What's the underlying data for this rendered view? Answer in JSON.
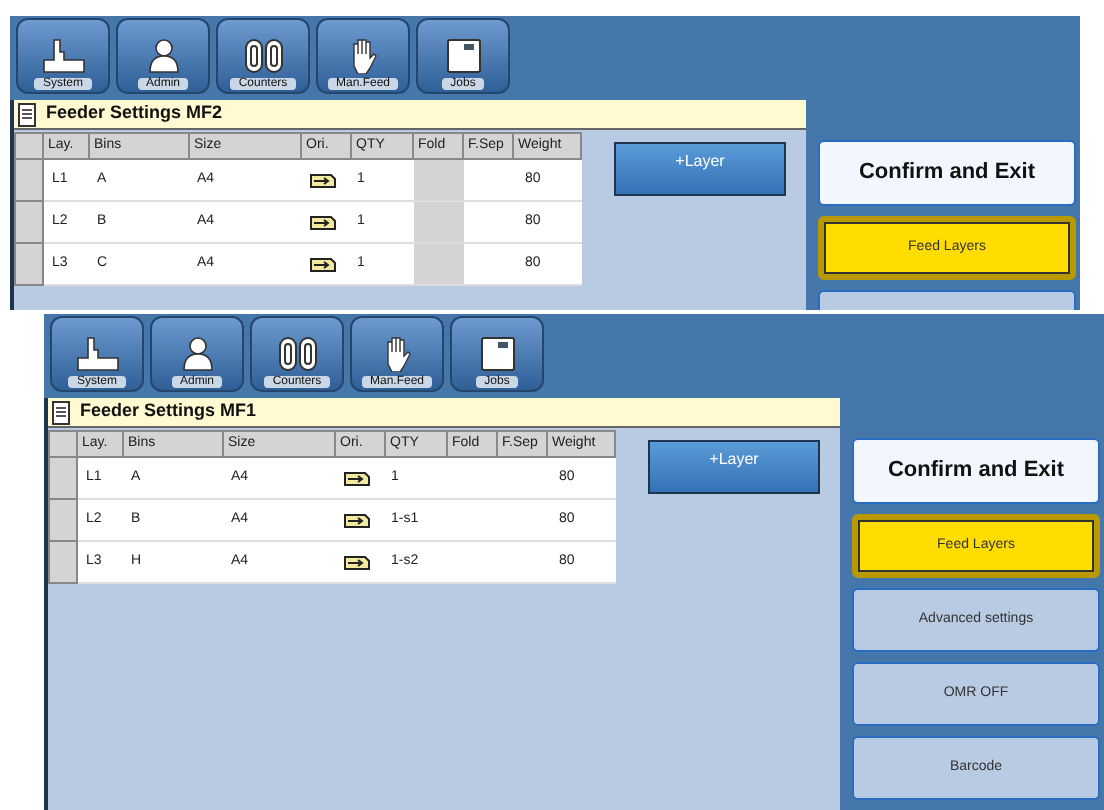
{
  "screens": [
    {
      "toolbar": [
        {
          "label": "System"
        },
        {
          "label": "Admin"
        },
        {
          "label": "Counters"
        },
        {
          "label": "Man.Feed"
        },
        {
          "label": "Jobs"
        }
      ],
      "title": "Feeder Settings MF2",
      "columns": [
        "Lay.",
        "Bins",
        "Size",
        "Ori.",
        "QTY",
        "Fold",
        "F.Sep",
        "Weight"
      ],
      "fold_disabled": true,
      "rows": [
        {
          "layer": "L1",
          "bin": "A",
          "size": "A4",
          "qty": "1",
          "weight": "80"
        },
        {
          "layer": "L2",
          "bin": "B",
          "size": "A4",
          "qty": "1",
          "weight": "80"
        },
        {
          "layer": "L3",
          "bin": "C",
          "size": "A4",
          "qty": "1",
          "weight": "80"
        }
      ],
      "add_layer_button": "+Layer",
      "side_buttons": [
        {
          "label": "Confirm and Exit",
          "kind": "confirm"
        },
        {
          "label": "Feed Layers",
          "kind": "option",
          "selected": true
        },
        {
          "kind": "option",
          "selected": false
        }
      ]
    },
    {
      "toolbar": [
        {
          "label": "System"
        },
        {
          "label": "Admin"
        },
        {
          "label": "Counters"
        },
        {
          "label": "Man.Feed"
        },
        {
          "label": "Jobs"
        }
      ],
      "title": "Feeder Settings MF1",
      "columns": [
        "Lay.",
        "Bins",
        "Size",
        "Ori.",
        "QTY",
        "Fold",
        "F.Sep",
        "Weight"
      ],
      "fold_disabled": false,
      "rows": [
        {
          "layer": "L1",
          "bin": "A",
          "size": "A4",
          "qty": "1",
          "weight": "80"
        },
        {
          "layer": "L2",
          "bin": "B",
          "size": "A4",
          "qty": "1-s1",
          "weight": "80"
        },
        {
          "layer": "L3",
          "bin": "H",
          "size": "A4",
          "qty": "1-s2",
          "weight": "80"
        }
      ],
      "add_layer_button": "+Layer",
      "side_buttons": [
        {
          "label": "Confirm and Exit",
          "kind": "confirm"
        },
        {
          "label": "Feed Layers",
          "kind": "option",
          "selected": true
        },
        {
          "label": "Advanced settings",
          "kind": "option",
          "selected": false
        },
        {
          "label": "OMR OFF",
          "kind": "option",
          "selected": false
        },
        {
          "label": "Barcode",
          "kind": "option",
          "selected": false
        }
      ]
    }
  ]
}
